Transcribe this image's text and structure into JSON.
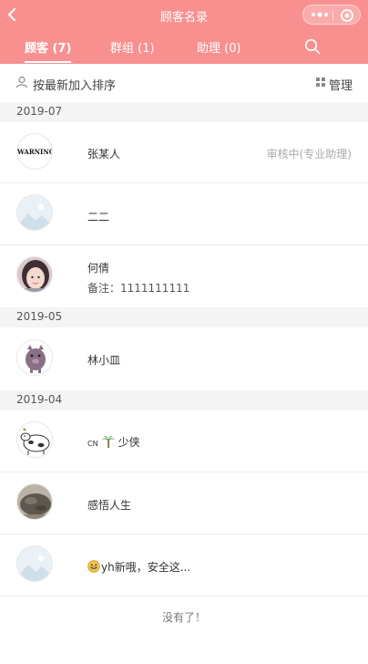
{
  "header": {
    "title": "顾客名录",
    "tabs": [
      {
        "label": "顾客 (7)",
        "active": true
      },
      {
        "label": "群组 (1)",
        "active": false
      },
      {
        "label": "助理 (0)",
        "active": false
      }
    ],
    "bg_color": "#f99090"
  },
  "sortbar": {
    "sort_label": "按最新加入排序",
    "manage_label": "管理"
  },
  "sections": [
    {
      "date": "2019-07",
      "customers": [
        {
          "name": "张某人",
          "avatar": "warning-avatar",
          "avatar_text": "WARNING",
          "status": "审核中(专业助理)"
        },
        {
          "name": "二二",
          "avatar": "default-avatar"
        },
        {
          "name": "何倩",
          "avatar": "girl-photo-avatar",
          "note": "备注：1111111111"
        }
      ]
    },
    {
      "date": "2019-05",
      "customers": [
        {
          "name": "林小皿",
          "avatar": "cartoon-pig-avatar"
        }
      ]
    },
    {
      "date": "2019-04",
      "customers": [
        {
          "name_prefix": "CN",
          "name_icon": "palm-tree-icon",
          "name": "少侠",
          "avatar": "sketch-cow-avatar"
        },
        {
          "name": "感悟人生",
          "avatar": "rock-photo-avatar"
        },
        {
          "name_icon": "grinning-face-icon",
          "name": "yh新哦，安全这...",
          "avatar": "default-avatar"
        }
      ]
    }
  ],
  "footer": {
    "text": "没有了！"
  }
}
